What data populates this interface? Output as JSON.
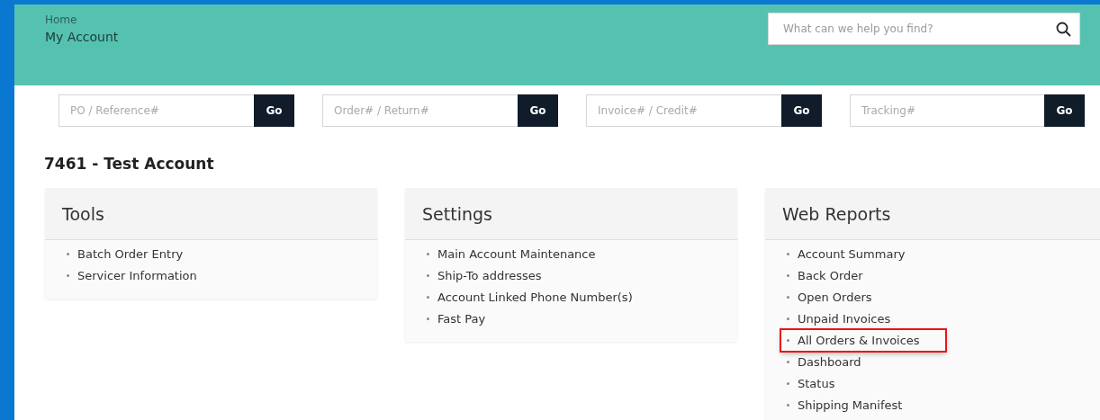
{
  "breadcrumb": [
    "Home",
    "My Account"
  ],
  "search": {
    "placeholder": "What can we help you find?"
  },
  "lookups": [
    {
      "placeholder": "PO / Reference#",
      "button": "Go"
    },
    {
      "placeholder": "Order# / Return#",
      "button": "Go"
    },
    {
      "placeholder": "Invoice# / Credit#",
      "button": "Go"
    },
    {
      "placeholder": "Tracking#",
      "button": "Go"
    }
  ],
  "account_title": "7461 - Test Account",
  "cards": [
    {
      "title": "Tools",
      "items": [
        {
          "label": "Batch Order Entry",
          "highlighted": false
        },
        {
          "label": "Servicer Information",
          "highlighted": false
        }
      ]
    },
    {
      "title": "Settings",
      "items": [
        {
          "label": "Main Account Maintenance",
          "highlighted": false
        },
        {
          "label": "Ship-To addresses",
          "highlighted": false
        },
        {
          "label": "Account Linked Phone Number(s)",
          "highlighted": false
        },
        {
          "label": "Fast Pay",
          "highlighted": false
        }
      ]
    },
    {
      "title": "Web Reports",
      "items": [
        {
          "label": "Account Summary",
          "highlighted": false
        },
        {
          "label": "Back Order",
          "highlighted": false
        },
        {
          "label": "Open Orders",
          "highlighted": false
        },
        {
          "label": "Unpaid Invoices",
          "highlighted": false
        },
        {
          "label": "All Orders & Invoices",
          "highlighted": true
        },
        {
          "label": "Dashboard",
          "highlighted": false
        },
        {
          "label": "Status",
          "highlighted": false
        },
        {
          "label": "Shipping Manifest",
          "highlighted": false
        }
      ]
    }
  ]
}
